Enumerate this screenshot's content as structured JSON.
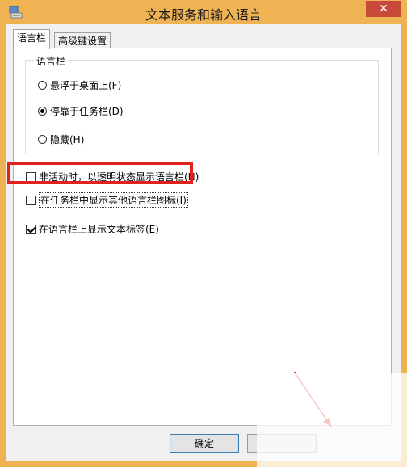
{
  "window": {
    "title": "文本服务和输入语言",
    "close_glyph": "✕"
  },
  "tabs": [
    {
      "label": "语言栏",
      "active": true
    },
    {
      "label": "高级键设置",
      "active": false
    }
  ],
  "language_bar_group": {
    "legend": "语言栏",
    "options": [
      {
        "label": "悬浮于桌面上(F)",
        "checked": false
      },
      {
        "label": "停靠于任务栏(D)",
        "checked": true
      },
      {
        "label": "隐藏(H)",
        "checked": false
      }
    ]
  },
  "checkboxes": [
    {
      "label": "非活动时，以透明状态显示语言栏(N)",
      "checked": false
    },
    {
      "label": "在任务栏中显示其他语言栏图标(I)",
      "checked": false
    },
    {
      "label": "在语言栏上显示文本标签(E)",
      "checked": true
    }
  ],
  "buttons": {
    "ok": "确定"
  },
  "colors": {
    "highlight": "#e0221f",
    "title_bar": "#f0b354",
    "close_button": "#c74a3a"
  }
}
